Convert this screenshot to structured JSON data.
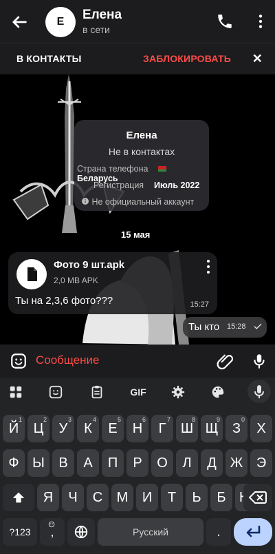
{
  "header": {
    "avatar_letter": "Е",
    "title": "Елена",
    "status": "в сети"
  },
  "actions": {
    "add_contact": "В КОНТАКТЫ",
    "block": "ЗАБЛОКИРОВАТЬ",
    "close": "✕"
  },
  "contact_card": {
    "name": "Елена",
    "subtitle": "Не в контактах",
    "phone_country_label": "Страна телефона",
    "phone_country_value": "Беларусь",
    "registration_label": "Регистрация",
    "registration_value": "Июль 2022",
    "official_note": "Не официальный аккаунт"
  },
  "chat": {
    "date_label": "15 мая",
    "incoming": {
      "file_name": "Фото 9 шт.apk",
      "file_size": "2,0 MB APK",
      "text": "Ты на 2,3,6 фото???",
      "time": "15:27"
    },
    "outgoing": {
      "text": "Ты кто",
      "time": "15:28"
    }
  },
  "compose": {
    "placeholder": "Сообщение"
  },
  "keyboard": {
    "toolbar": {
      "gif": "GIF"
    },
    "row1": [
      {
        "k": "Й",
        "s": "1"
      },
      {
        "k": "Ц",
        "s": "2"
      },
      {
        "k": "У",
        "s": "3"
      },
      {
        "k": "К",
        "s": "4"
      },
      {
        "k": "Е",
        "s": "5"
      },
      {
        "k": "Н",
        "s": "6"
      },
      {
        "k": "Г",
        "s": "7"
      },
      {
        "k": "Ш",
        "s": "8"
      },
      {
        "k": "Щ",
        "s": "9"
      },
      {
        "k": "З",
        "s": "0"
      },
      {
        "k": "Х",
        "s": ""
      }
    ],
    "row2": [
      "Ф",
      "Ы",
      "В",
      "А",
      "П",
      "Р",
      "О",
      "Л",
      "Д",
      "Ж",
      "Э"
    ],
    "row3": [
      "Я",
      "Ч",
      "С",
      "М",
      "И",
      "Т",
      "Ь",
      "Б",
      "Ю"
    ],
    "bottom": {
      "num": "?123",
      "comma": ",",
      "space": "Русский",
      "period": "."
    }
  },
  "colors": {
    "accent_red": "#ff4b47",
    "enter_key": "#bcd3ff"
  }
}
